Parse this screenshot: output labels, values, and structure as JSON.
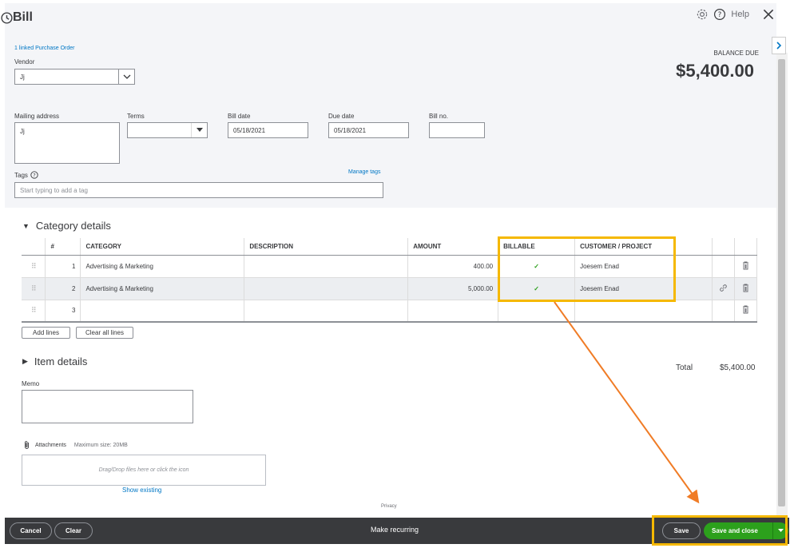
{
  "header": {
    "title": "Bill",
    "help_label": "Help"
  },
  "linked_po": "1 linked Purchase Order",
  "vendor": {
    "label": "Vendor",
    "value": "Jj"
  },
  "balance": {
    "label": "BALANCE DUE",
    "amount": "$5,400.00"
  },
  "mailing": {
    "label": "Mailing address",
    "value": "Jj"
  },
  "terms": {
    "label": "Terms",
    "value": ""
  },
  "bill_date": {
    "label": "Bill date",
    "value": "05/18/2021"
  },
  "due_date": {
    "label": "Due date",
    "value": "05/18/2021"
  },
  "bill_no": {
    "label": "Bill no.",
    "value": ""
  },
  "tags": {
    "label": "Tags",
    "manage": "Manage tags",
    "placeholder": "Start typing to add a tag"
  },
  "category": {
    "title": "Category details",
    "columns": [
      "#",
      "CATEGORY",
      "DESCRIPTION",
      "AMOUNT",
      "BILLABLE",
      "CUSTOMER / PROJECT"
    ],
    "rows": [
      {
        "num": "1",
        "category": "Advertising & Marketing",
        "description": "",
        "amount": "400.00",
        "billable": "✓",
        "customer": "Joesem Enad"
      },
      {
        "num": "2",
        "category": "Advertising & Marketing",
        "description": "",
        "amount": "5,000.00",
        "billable": "✓",
        "customer": "Joesem Enad"
      },
      {
        "num": "3",
        "category": "",
        "description": "",
        "amount": "",
        "billable": "",
        "customer": ""
      }
    ],
    "add_lines": "Add lines",
    "clear_lines": "Clear all lines"
  },
  "item_details": {
    "title": "Item details"
  },
  "total": {
    "label": "Total",
    "value": "$5,400.00"
  },
  "memo": {
    "label": "Memo"
  },
  "attachments": {
    "label": "Attachments",
    "max": "Maximum size: 20MB",
    "drop": "Drag/Drop files here or click the icon",
    "show": "Show existing"
  },
  "privacy": "Privacy",
  "footer": {
    "cancel": "Cancel",
    "clear": "Clear",
    "recurring": "Make recurring",
    "save": "Save",
    "save_close": "Save and close"
  },
  "colors": {
    "accent_green": "#2ca01c",
    "link_blue": "#0077c5",
    "highlight": "#f5b800",
    "arrow": "#f07c26",
    "footer_bg": "#393a3d"
  }
}
